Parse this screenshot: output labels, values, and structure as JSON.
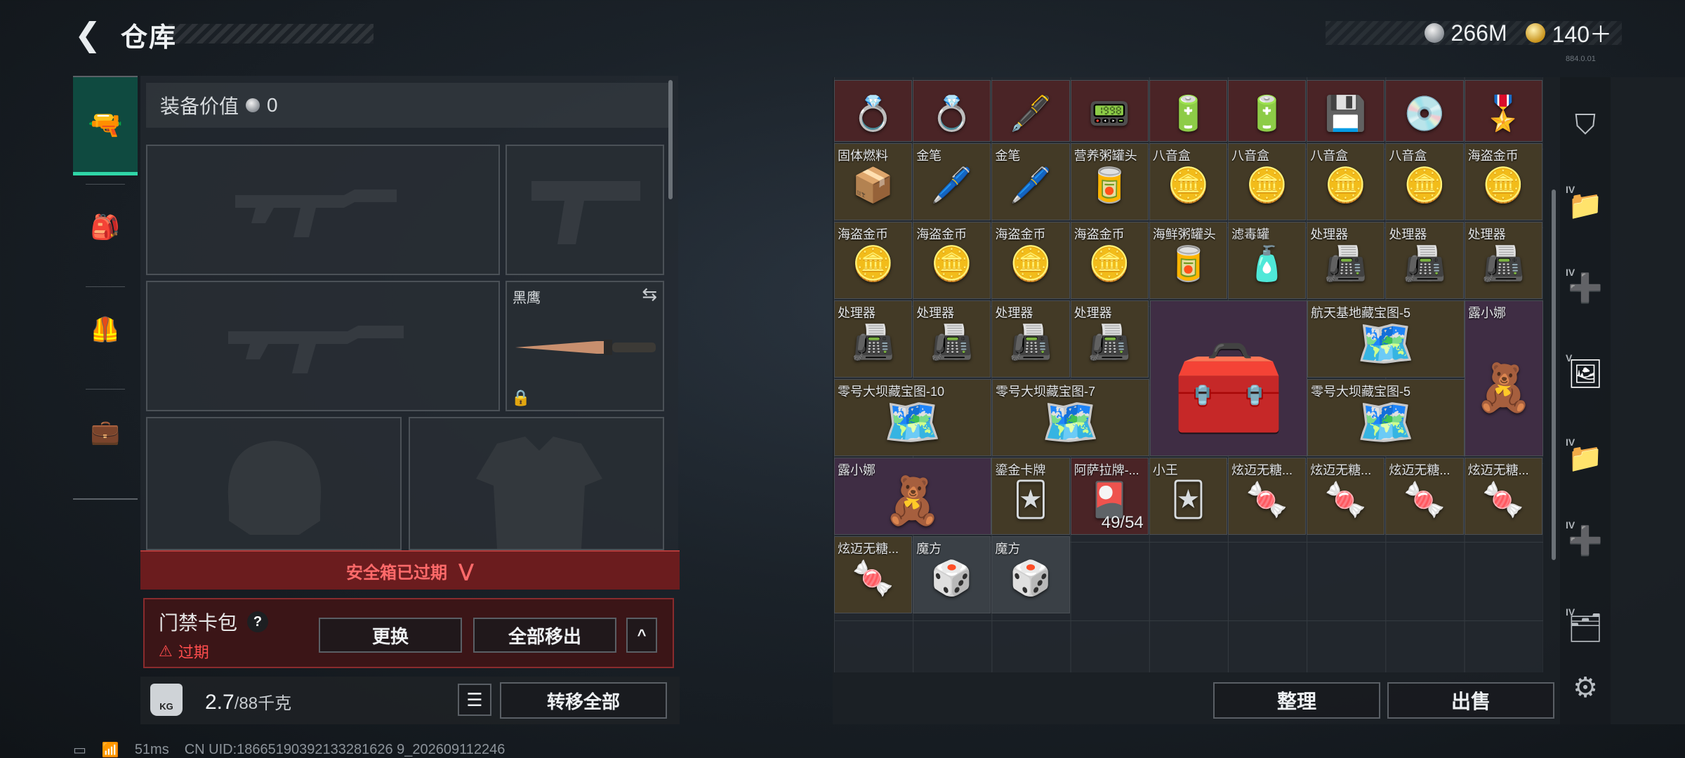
{
  "header": {
    "back_icon": "back-arrow-icon",
    "title": "仓库"
  },
  "currency": {
    "silver": "266M",
    "gold": "140＋"
  },
  "left_nav": [
    "weapon-tab-icon",
    "backpack-tab-icon",
    "vest-tab-icon",
    "case-tab-icon"
  ],
  "equipment": {
    "value_label": "装备价值",
    "value": "0",
    "knife_name": "黑鹰"
  },
  "safebox": {
    "status": "安全箱已过期"
  },
  "keycard": {
    "title": "门禁卡包",
    "help": "?",
    "status": "过期",
    "replace_button": "更换",
    "move_all_out_button": "全部移出",
    "collapse_icon": "^"
  },
  "weight": {
    "icon_text": "KG",
    "current": "2.7",
    "max": "/88千克",
    "transfer_all_button": "转移全部"
  },
  "stash": {
    "row0": [
      {
        "name": "",
        "icon": "💍",
        "color": "c-red"
      },
      {
        "name": "",
        "icon": "💍",
        "color": "c-red"
      },
      {
        "name": "",
        "icon": "🖋️",
        "color": "c-red"
      },
      {
        "name": "",
        "icon": "📟",
        "color": "c-red"
      },
      {
        "name": "",
        "icon": "🔋",
        "color": "c-red"
      },
      {
        "name": "",
        "icon": "🔋",
        "color": "c-red"
      },
      {
        "name": "",
        "icon": "💾",
        "color": "c-red"
      },
      {
        "name": "",
        "icon": "💿",
        "color": "c-red"
      },
      {
        "name": "",
        "icon": "🎖️",
        "color": "c-red"
      }
    ],
    "row1": [
      {
        "name": "固体燃料",
        "icon": "📦",
        "color": "c-gold"
      },
      {
        "name": "金笔",
        "icon": "🖊️",
        "color": "c-gold"
      },
      {
        "name": "金笔",
        "icon": "🖊️",
        "color": "c-gold"
      },
      {
        "name": "营养粥罐头",
        "icon": "🥫",
        "color": "c-gold"
      },
      {
        "name": "八音盒",
        "icon": "🪙",
        "color": "c-gold"
      },
      {
        "name": "八音盒",
        "icon": "🪙",
        "color": "c-gold"
      },
      {
        "name": "八音盒",
        "icon": "🪙",
        "color": "c-gold"
      },
      {
        "name": "八音盒",
        "icon": "🪙",
        "color": "c-gold"
      },
      {
        "name": "海盗金币",
        "icon": "🪙",
        "color": "c-gold"
      }
    ],
    "row2": [
      {
        "name": "海盗金币",
        "icon": "🪙",
        "color": "c-gold"
      },
      {
        "name": "海盗金币",
        "icon": "🪙",
        "color": "c-gold"
      },
      {
        "name": "海盗金币",
        "icon": "🪙",
        "color": "c-gold"
      },
      {
        "name": "海盗金币",
        "icon": "🪙",
        "color": "c-gold"
      },
      {
        "name": "海鲜粥罐头",
        "icon": "🥫",
        "color": "c-gold"
      },
      {
        "name": "滤毒罐",
        "icon": "🧴",
        "color": "c-gold"
      },
      {
        "name": "处理器",
        "icon": "📠",
        "color": "c-gold"
      },
      {
        "name": "处理器",
        "icon": "📠",
        "color": "c-gold"
      },
      {
        "name": "处理器",
        "icon": "📠",
        "color": "c-gold"
      }
    ],
    "row3": [
      {
        "name": "处理器",
        "icon": "📠",
        "color": "c-gold"
      },
      {
        "name": "处理器",
        "icon": "📠",
        "color": "c-gold"
      },
      {
        "name": "处理器",
        "icon": "📠",
        "color": "c-gold"
      },
      {
        "name": "处理器",
        "icon": "📠",
        "color": "c-gold"
      }
    ],
    "big_case_icon": "🧰",
    "map1_name": "航天基地藏宝图-5",
    "map2_name": "零号大坝藏宝图-10",
    "map3_name": "零号大坝藏宝图-7",
    "map4_name": "零号大坝藏宝图-5",
    "doll1_name": "露小娜",
    "doll2_name": "露小娜",
    "map_icon": "🗺️",
    "doll_icon": "🧸",
    "row5": [
      {
        "name": "鎏金卡牌",
        "icon": "🃏",
        "color": "c-gold"
      },
      {
        "name": "阿萨拉牌-...",
        "icon": "🎴",
        "color": "c-red",
        "count": "49/54"
      },
      {
        "name": "小王",
        "icon": "🃏",
        "color": "c-gold"
      },
      {
        "name": "炫迈无糖...",
        "icon": "🍬",
        "color": "c-gold"
      },
      {
        "name": "炫迈无糖...",
        "icon": "🍬",
        "color": "c-gold"
      },
      {
        "name": "炫迈无糖...",
        "icon": "🍬",
        "color": "c-gold"
      },
      {
        "name": "炫迈无糖...",
        "icon": "🍬",
        "color": "c-gold"
      }
    ],
    "row6": [
      {
        "name": "炫迈无糖...",
        "icon": "🍬",
        "color": "c-gold"
      },
      {
        "name": "魔方",
        "icon": "🎲",
        "color": "c-grey"
      },
      {
        "name": "魔方",
        "icon": "🎲",
        "color": "c-grey"
      }
    ],
    "organize_button": "整理",
    "sell_button": "出售"
  },
  "right_rail": {
    "items": [
      {
        "icon": "⛉",
        "sub": ""
      },
      {
        "icon": "📁",
        "sub": "IV"
      },
      {
        "icon": "➕",
        "sub": "IV"
      },
      {
        "icon": "🖼",
        "sub": "V"
      },
      {
        "icon": "📁",
        "sub": "IV"
      },
      {
        "icon": "➕",
        "sub": "IV"
      },
      {
        "icon": "🗂",
        "sub": "IV"
      }
    ],
    "settings_icon": "⚙"
  },
  "status_line": {
    "ping": "51ms",
    "uid": "CN UID:18665190392133281626 9_202609112246"
  },
  "version_tag": "884.0.01"
}
